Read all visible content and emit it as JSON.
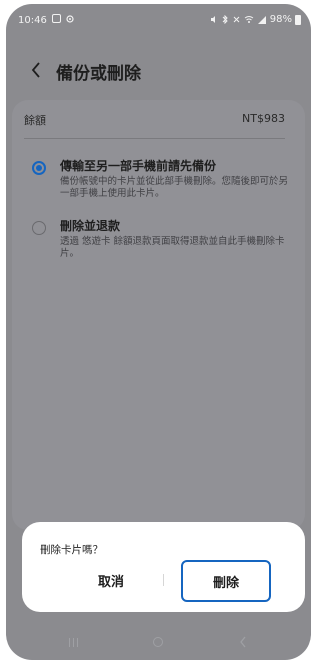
{
  "status_bar": {
    "time": "10:46",
    "battery": "98%",
    "icons": [
      "gallery-icon",
      "settings-icon",
      "mute-icon",
      "bluetooth-icon",
      "nfc-icon",
      "wifi-icon",
      "signal-icon",
      "battery-icon"
    ]
  },
  "header": {
    "back_icon": "chevron-left-icon",
    "title": "備份或刪除"
  },
  "balance": {
    "label": "餘額",
    "value": "NT$983"
  },
  "options": [
    {
      "title": "傳輸至另一部手機前請先備份",
      "description": "備份帳號中的卡片並從此部手機刪除。您隨後即可於另一部手機上使用此卡片。",
      "selected": true
    },
    {
      "title": "刪除並退款",
      "description": "透過 悠遊卡 餘額退款頁面取得退款並自此手機刪除卡片。",
      "selected": false
    }
  ],
  "dialog": {
    "message": "刪除卡片嗎？",
    "cancel_label": "取消",
    "delete_label": "刪除"
  },
  "nav_bar": {
    "icons": [
      "recent-apps-icon",
      "home-icon",
      "back-icon"
    ]
  },
  "colors": {
    "accent": "#1565c0",
    "dim_background": "#8b8b8f",
    "dialog_background": "#ffffff"
  }
}
